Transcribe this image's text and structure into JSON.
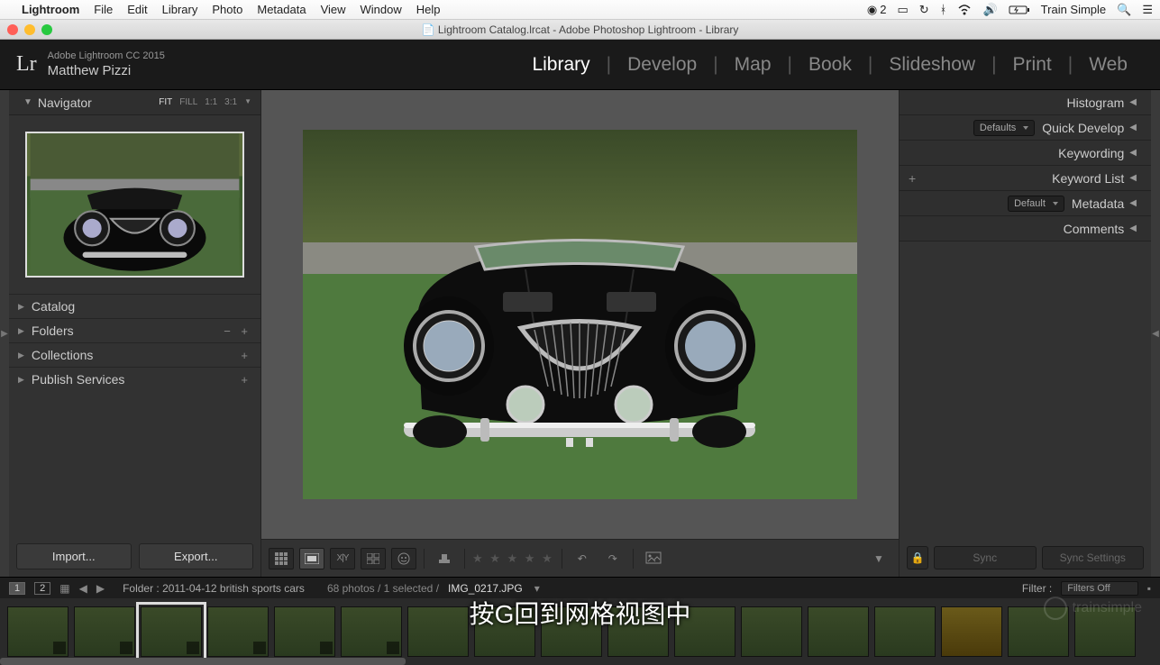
{
  "menubar": {
    "apple": "",
    "app": "Lightroom",
    "items": [
      "File",
      "Edit",
      "Library",
      "Photo",
      "Metadata",
      "View",
      "Window",
      "Help"
    ],
    "cloud_count": "2",
    "user": "Train Simple"
  },
  "titlebar": {
    "title": "Lightroom Catalog.lrcat - Adobe Photoshop Lightroom - Library"
  },
  "header": {
    "logo": "Lr",
    "product": "Adobe Lightroom CC 2015",
    "user": "Matthew Pizzi",
    "modules": [
      "Library",
      "Develop",
      "Map",
      "Book",
      "Slideshow",
      "Print",
      "Web"
    ],
    "active_module": "Library"
  },
  "left": {
    "navigator": {
      "label": "Navigator",
      "opts": [
        "FIT",
        "FILL",
        "1:1",
        "3:1"
      ],
      "active_opt": "FIT"
    },
    "items": [
      {
        "label": "Catalog",
        "pm": ""
      },
      {
        "label": "Folders",
        "pm": "−  +"
      },
      {
        "label": "Collections",
        "pm": "+"
      },
      {
        "label": "Publish Services",
        "pm": "+"
      }
    ],
    "import": "Import...",
    "export": "Export..."
  },
  "right": {
    "panels": [
      {
        "label": "Histogram",
        "dd": null,
        "plus": false
      },
      {
        "label": "Quick Develop",
        "dd": "Defaults",
        "plus": false
      },
      {
        "label": "Keywording",
        "dd": null,
        "plus": false
      },
      {
        "label": "Keyword List",
        "dd": null,
        "plus": true
      },
      {
        "label": "Metadata",
        "dd": "Default",
        "plus": false
      },
      {
        "label": "Comments",
        "dd": null,
        "plus": false
      }
    ],
    "sync": "Sync",
    "sync_settings": "Sync Settings"
  },
  "filmstrip_head": {
    "pages": [
      "1",
      "2"
    ],
    "path_label": "Folder : 2011-04-12 british sports cars",
    "count": "68 photos / 1 selected /",
    "filename": "IMG_0217.JPG",
    "filter_label": "Filter :",
    "filter_value": "Filters Off"
  },
  "subtitle": "按G回到网格视图中",
  "watermark": "trainsimple"
}
